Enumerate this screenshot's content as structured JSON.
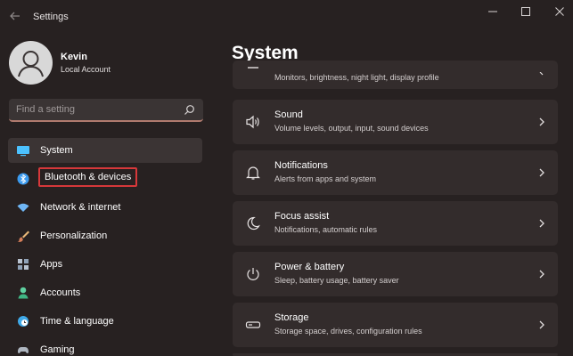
{
  "window": {
    "title": "Settings"
  },
  "user": {
    "name": "Kevin",
    "account": "Local Account"
  },
  "search": {
    "placeholder": "Find a setting"
  },
  "sidebar": {
    "items": [
      {
        "label": "System",
        "icon": "monitor-icon",
        "active": true
      },
      {
        "label": "Bluetooth & devices",
        "icon": "bluetooth-icon",
        "highlighted": true
      },
      {
        "label": "Network & internet",
        "icon": "wifi-icon"
      },
      {
        "label": "Personalization",
        "icon": "brush-icon"
      },
      {
        "label": "Apps",
        "icon": "apps-icon"
      },
      {
        "label": "Accounts",
        "icon": "person-icon"
      },
      {
        "label": "Time & language",
        "icon": "globe-icon"
      },
      {
        "label": "Gaming",
        "icon": "gamepad-icon"
      }
    ]
  },
  "main": {
    "title": "System",
    "cards": [
      {
        "title": "",
        "subtitle": "Monitors, brightness, night light, display profile",
        "icon": "display-icon"
      },
      {
        "title": "Sound",
        "subtitle": "Volume levels, output, input, sound devices",
        "icon": "speaker-icon"
      },
      {
        "title": "Notifications",
        "subtitle": "Alerts from apps and system",
        "icon": "bell-icon"
      },
      {
        "title": "Focus assist",
        "subtitle": "Notifications, automatic rules",
        "icon": "moon-icon"
      },
      {
        "title": "Power & battery",
        "subtitle": "Sleep, battery usage, battery saver",
        "icon": "power-icon"
      },
      {
        "title": "Storage",
        "subtitle": "Storage space, drives, configuration rules",
        "icon": "storage-icon"
      }
    ]
  },
  "colors": {
    "background": "#272121",
    "card": "#332c2c",
    "active_item": "#3b3434",
    "highlight_border": "#d6383a",
    "accent_system_icon": "#4cc2ff",
    "accent_bluetooth_icon": "#3b9bf0"
  }
}
